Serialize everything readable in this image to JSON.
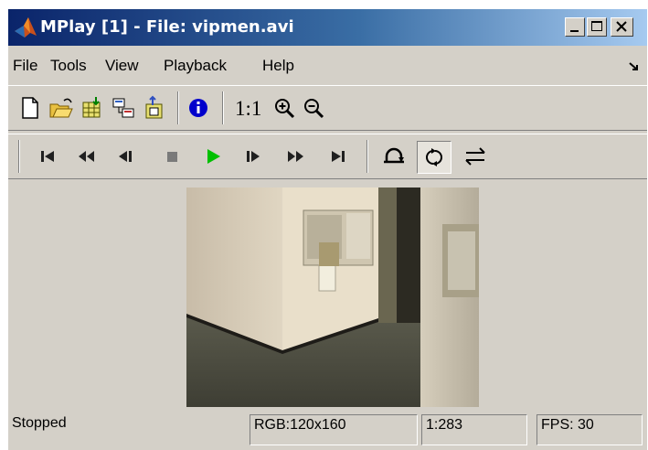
{
  "window": {
    "title": "MPlay [1] - File: vipmen.avi",
    "controls": [
      "minimize",
      "maximize",
      "close"
    ]
  },
  "menu": {
    "items": [
      "File",
      "Tools",
      "View",
      "Playback",
      "Help"
    ],
    "corner_icon": "dock-arrow-icon"
  },
  "toolbar": {
    "buttons": [
      "new-file-icon",
      "open-file-icon",
      "import-workspace-icon",
      "connect-simulink-icon",
      "export-icon",
      "info-icon"
    ],
    "zoom_label": "1:1",
    "zoom_buttons": [
      "zoom-in-icon",
      "zoom-out-icon"
    ]
  },
  "playback": {
    "buttons": [
      "go-to-start-icon",
      "rewind-icon",
      "step-back-icon",
      "stop-icon",
      "play-icon",
      "step-forward-icon",
      "fast-forward-icon",
      "go-to-end-icon"
    ],
    "modes": [
      "jump-to-frame-icon",
      "repeat-icon",
      "forward-backward-icon"
    ],
    "repeat_active": true
  },
  "colors": {
    "play": "#00c000",
    "stop": "#7a7a7a",
    "titlebar_start": "#0a246a",
    "titlebar_end": "#a6caf0",
    "info": "#0000cc"
  },
  "status": {
    "state": "Stopped",
    "image_info": "RGB:120x160",
    "frame": "1:283",
    "fps": "FPS: 30"
  }
}
